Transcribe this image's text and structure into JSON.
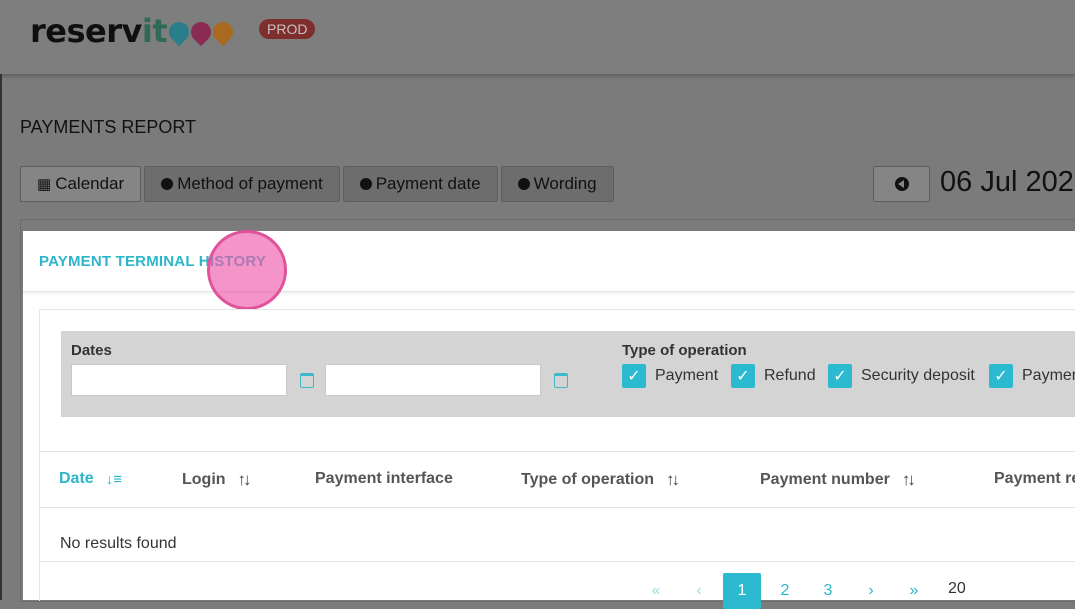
{
  "app": {
    "logo_text_a": "reserv",
    "logo_text_b": "it",
    "env_badge": "PROD",
    "pin_colors": [
      "#2a7d8a",
      "#8a2b52",
      "#a86a1f"
    ]
  },
  "page": {
    "title": "PAYMENTS REPORT",
    "tabs": [
      {
        "label": "Calendar",
        "icon": "calendar-icon"
      },
      {
        "label": "Method of payment",
        "icon": "chevron-down-circle-icon"
      },
      {
        "label": "Payment date",
        "icon": "chevron-down-circle-icon"
      },
      {
        "label": "Wording",
        "icon": "chevron-down-circle-icon"
      }
    ],
    "current_date": "06 Jul 202"
  },
  "modal": {
    "title": "PAYMENT TERMINAL HISTORY",
    "filters": {
      "dates_label": "Dates",
      "date_from": "",
      "date_to": "",
      "type_label": "Type of operation",
      "types": [
        {
          "label": "Payment",
          "checked": true
        },
        {
          "label": "Refund",
          "checked": true
        },
        {
          "label": "Security deposit",
          "checked": true
        },
        {
          "label": "Paymer",
          "checked": true
        }
      ]
    },
    "table": {
      "columns": [
        {
          "label": "Date",
          "sort": "desc-active"
        },
        {
          "label": "Login",
          "sort": "both"
        },
        {
          "label": "Payment interface",
          "sort": "none"
        },
        {
          "label": "Type of operation",
          "sort": "both"
        },
        {
          "label": "Payment number",
          "sort": "both"
        },
        {
          "label": "Payment re",
          "sort": "none"
        }
      ],
      "empty_text": "No results found"
    },
    "pagination": {
      "first": "«",
      "prev": "‹",
      "pages": [
        "1",
        "2",
        "3"
      ],
      "current": "1",
      "next": "›",
      "last": "»",
      "page_size": "20"
    }
  },
  "colors": {
    "accent": "#2db5c9",
    "highlight": "#e0529c"
  }
}
